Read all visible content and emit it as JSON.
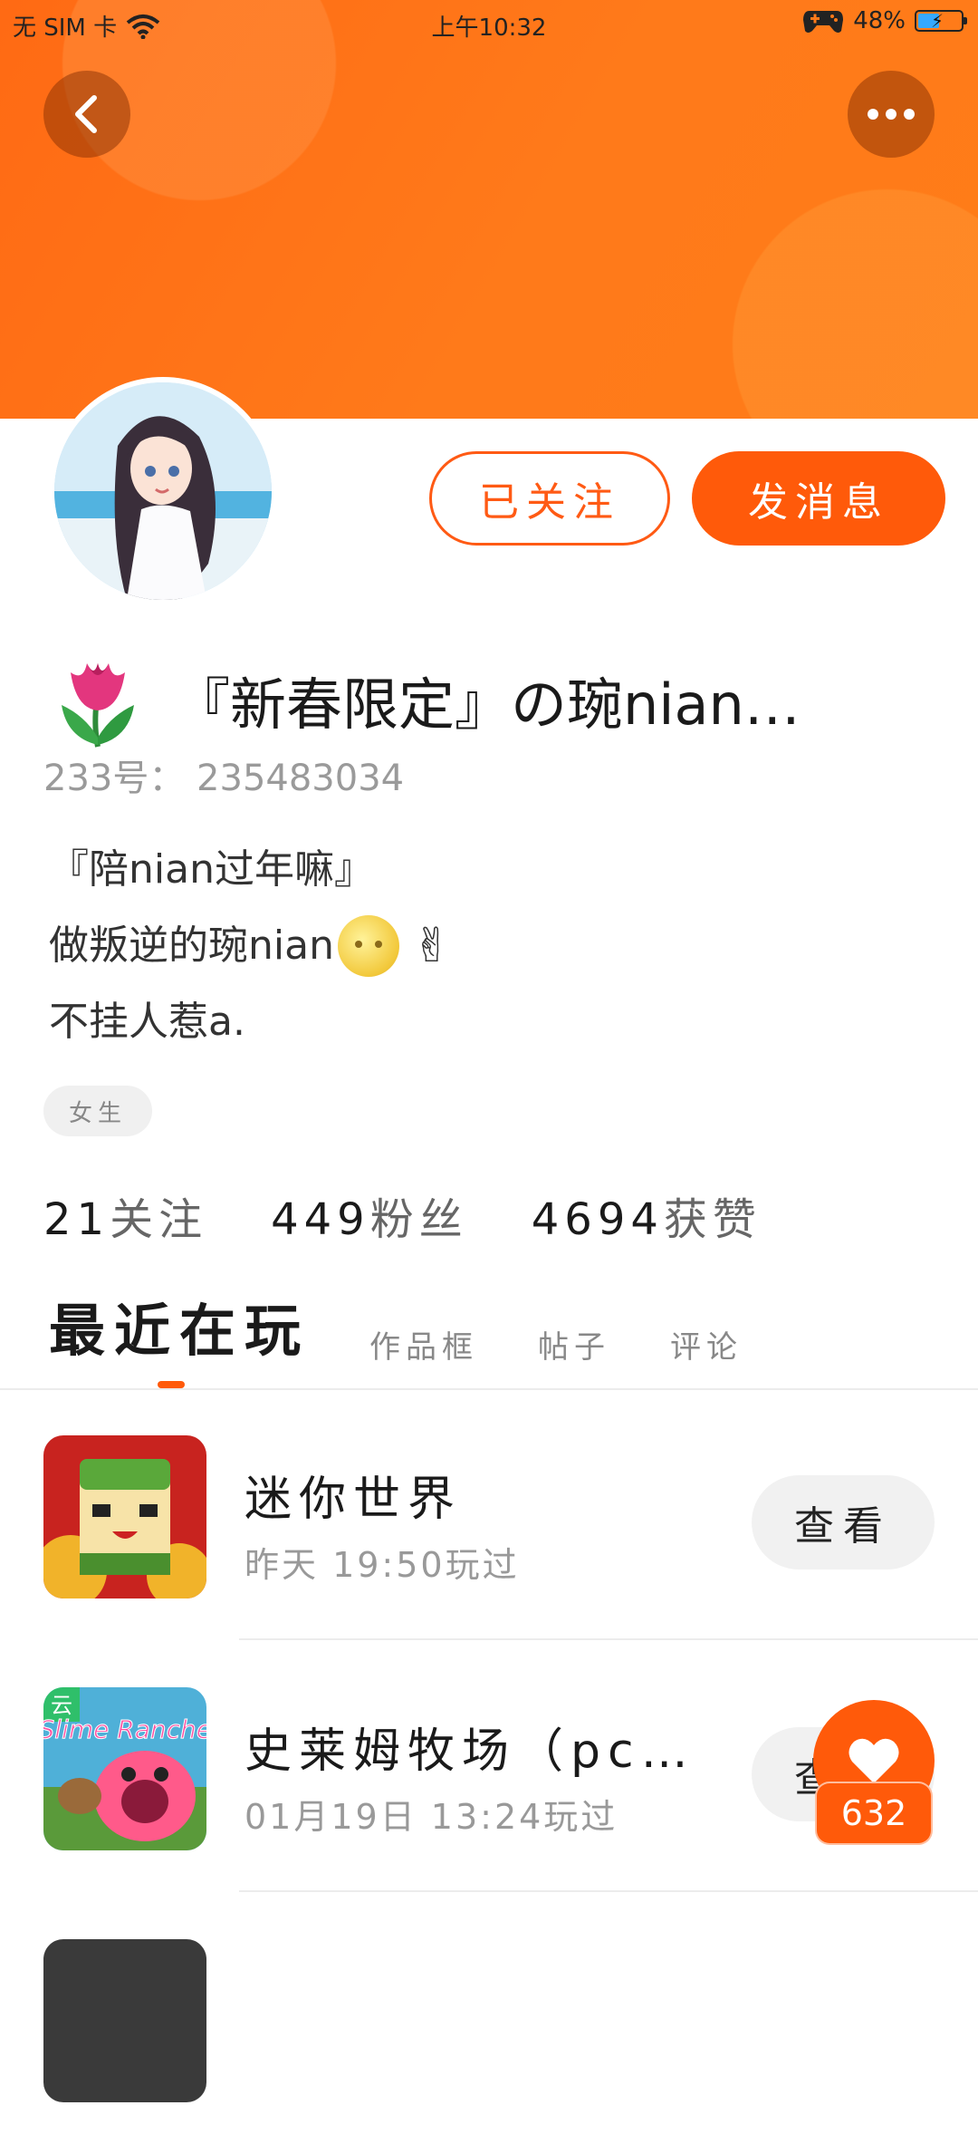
{
  "status_bar": {
    "sim": "无 SIM 卡",
    "time": "上午10:32",
    "battery": "48%"
  },
  "profile": {
    "follow_label": "已关注",
    "message_label": "发消息",
    "name": "『新春限定』の琬nian…",
    "uid": "233号： 235483034",
    "bio": [
      "『陪nian过年嘛』",
      "做叛逆的琬nian",
      "不挂人惹a."
    ],
    "gender_tag": "女生",
    "stats": [
      {
        "num": "21",
        "label": "关注"
      },
      {
        "num": "449",
        "label": "粉丝"
      },
      {
        "num": "4694",
        "label": "获赞"
      }
    ]
  },
  "tabs": [
    {
      "label": "最近在玩",
      "active": true
    },
    {
      "label": "作品框",
      "active": false
    },
    {
      "label": "帖子",
      "active": false
    },
    {
      "label": "评论",
      "active": false
    }
  ],
  "games": [
    {
      "title": "迷你世界",
      "played": "昨天 19:50玩过",
      "button": "查看",
      "icon": "mini-world-icon"
    },
    {
      "title": "史莱姆牧场（pc…",
      "played": "01月19日 13:24玩过",
      "button": "查看",
      "icon": "slime-rancher-icon",
      "badge": "云",
      "logo_text": "Slime Rancher"
    }
  ],
  "like": {
    "count": "632"
  },
  "colors": {
    "accent": "#ff5a0a",
    "header": "#ff7418"
  }
}
